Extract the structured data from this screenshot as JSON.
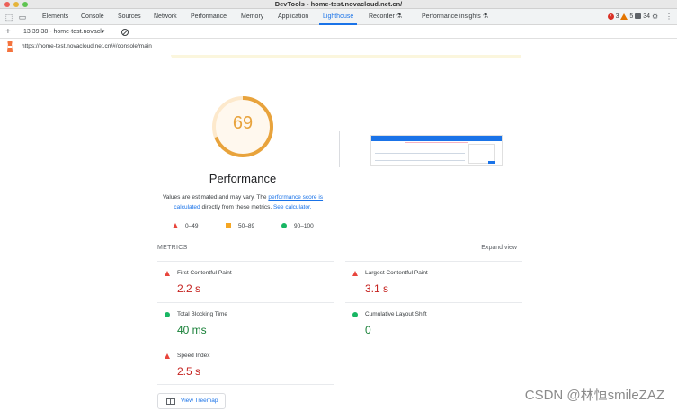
{
  "window": {
    "title": "DevTools - home-test.novacloud.net.cn/"
  },
  "tabs": [
    {
      "label": "Elements"
    },
    {
      "label": "Console"
    },
    {
      "label": "Sources"
    },
    {
      "label": "Network"
    },
    {
      "label": "Performance"
    },
    {
      "label": "Memory"
    },
    {
      "label": "Application"
    },
    {
      "label": "Lighthouse"
    },
    {
      "label": "Recorder ⚗"
    },
    {
      "label": "Performance insights ⚗"
    }
  ],
  "badges": {
    "errors": "3",
    "warnings": "5",
    "messages": "34"
  },
  "lighthouse_bar": {
    "report_select": "13:39:38 - home-test.novacl▾"
  },
  "url": "https://home-test.novacloud.net.cn/#/console/main",
  "score": {
    "value": 69,
    "display": "69",
    "label": "Performance",
    "color": "#e8a33c"
  },
  "description": {
    "prefix": "Values are estimated and may vary. The ",
    "link1": "performance score is calculated",
    "middle": " directly from these metrics. ",
    "link2": "See calculator."
  },
  "legend": [
    {
      "range": "0–49",
      "shape": "triangle",
      "color": "#e8453c"
    },
    {
      "range": "50–89",
      "shape": "square",
      "color": "#f5a623"
    },
    {
      "range": "90–100",
      "shape": "circle",
      "color": "#18b663"
    }
  ],
  "metrics": {
    "title": "METRICS",
    "expand": "Expand view",
    "items": [
      {
        "label": "First Contentful Paint",
        "value": "2.2 s",
        "status": "fail"
      },
      {
        "label": "Largest Contentful Paint",
        "value": "3.1 s",
        "status": "fail"
      },
      {
        "label": "Total Blocking Time",
        "value": "40 ms",
        "status": "pass"
      },
      {
        "label": "Cumulative Layout Shift",
        "value": "0",
        "status": "pass"
      },
      {
        "label": "Speed Index",
        "value": "2.5 s",
        "status": "fail"
      }
    ]
  },
  "treemap_button": {
    "label": "View Treemap"
  },
  "watermark": "CSDN @林恒smileZAZ"
}
